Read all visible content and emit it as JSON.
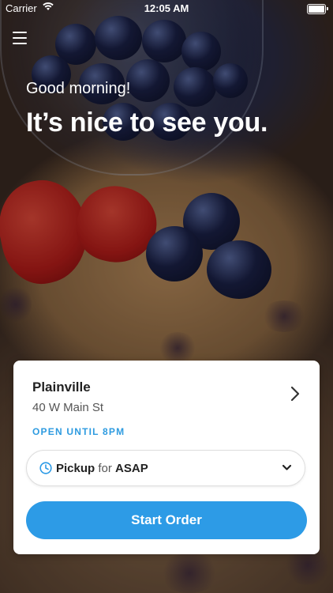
{
  "status_bar": {
    "carrier": "Carrier",
    "time": "12:05 AM",
    "icons": [
      "wifi-icon",
      "battery-icon"
    ]
  },
  "header": {
    "menu_icon": "hamburger-menu-icon",
    "greeting": "Good morning!",
    "headline": "It’s nice to see you."
  },
  "location": {
    "name": "Plainville",
    "address": "40 W Main St",
    "hours": "OPEN UNTIL 8PM"
  },
  "order_mode": {
    "mode": "Pickup",
    "connector": "for",
    "time": "ASAP"
  },
  "actions": {
    "start_order": "Start Order"
  },
  "colors": {
    "accent": "#2d9be6",
    "hours_text": "#2e9be0"
  }
}
